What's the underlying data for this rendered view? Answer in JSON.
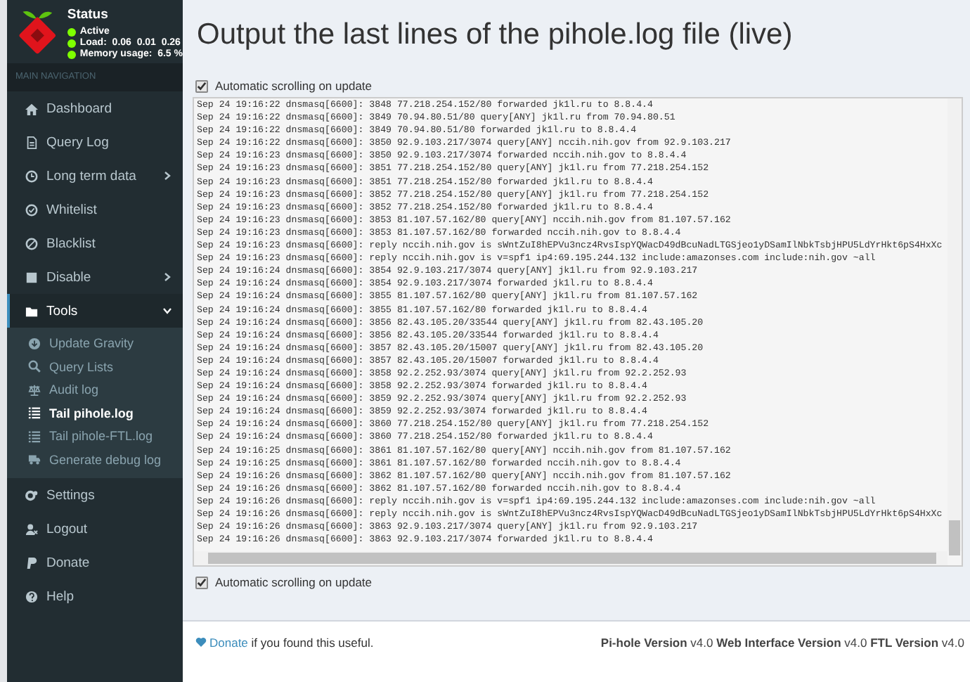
{
  "status": {
    "title": "Status",
    "lines": [
      "Active",
      "Load:  0.06  0.01  0.26",
      "Memory usage:  6.5 %"
    ]
  },
  "sidebar": {
    "header": "MAIN NAVIGATION",
    "items": [
      {
        "label": "Dashboard",
        "selected": false
      },
      {
        "label": "Query Log",
        "selected": false
      },
      {
        "label": "Long term data",
        "selected": false,
        "expanded": false
      },
      {
        "label": "Whitelist",
        "selected": false
      },
      {
        "label": "Blacklist",
        "selected": false
      },
      {
        "label": "Disable",
        "selected": false,
        "expanded": false
      },
      {
        "label": "Tools",
        "selected": true,
        "expanded": true,
        "children": [
          {
            "label": "Update Gravity",
            "selected": false
          },
          {
            "label": "Query Lists",
            "selected": false
          },
          {
            "label": "Audit log",
            "selected": false
          },
          {
            "label": "Tail pihole.log",
            "selected": true
          },
          {
            "label": "Tail pihole-FTL.log",
            "selected": false
          },
          {
            "label": "Generate debug log",
            "selected": false
          }
        ]
      },
      {
        "label": "Settings",
        "selected": false
      },
      {
        "label": "Logout",
        "selected": false
      },
      {
        "label": "Donate",
        "selected": false
      },
      {
        "label": "Help",
        "selected": false
      }
    ]
  },
  "page": {
    "title": "Output the last lines of the pihole.log file (live)",
    "top_option": {
      "label": "Automatic scrolling on update",
      "checked": true
    },
    "log": [
      "Sep 24 19:16:22 dnsmasq[6600]: 3848 77.218.254.152/80 forwarded jk1l.ru to 8.8.4.4",
      "Sep 24 19:16:22 dnsmasq[6600]: 3849 70.94.80.51/80 query[ANY] jk1l.ru from 70.94.80.51",
      "Sep 24 19:16:22 dnsmasq[6600]: 3849 70.94.80.51/80 forwarded jk1l.ru to 8.8.4.4",
      "Sep 24 19:16:22 dnsmasq[6600]: 3850 92.9.103.217/3074 query[ANY] nccih.nih.gov from 92.9.103.217",
      "Sep 24 19:16:23 dnsmasq[6600]: 3850 92.9.103.217/3074 forwarded nccih.nih.gov to 8.8.4.4",
      "Sep 24 19:16:23 dnsmasq[6600]: 3851 77.218.254.152/80 query[ANY] jk1l.ru from 77.218.254.152",
      "Sep 24 19:16:23 dnsmasq[6600]: 3851 77.218.254.152/80 forwarded jk1l.ru to 8.8.4.4",
      "Sep 24 19:16:23 dnsmasq[6600]: 3852 77.218.254.152/80 query[ANY] jk1l.ru from 77.218.254.152",
      "Sep 24 19:16:23 dnsmasq[6600]: 3852 77.218.254.152/80 forwarded jk1l.ru to 8.8.4.4",
      "Sep 24 19:16:23 dnsmasq[6600]: 3853 81.107.57.162/80 query[ANY] nccih.nih.gov from 81.107.57.162",
      "Sep 24 19:16:23 dnsmasq[6600]: 3853 81.107.57.162/80 forwarded nccih.nih.gov to 8.8.4.4",
      "Sep 24 19:16:23 dnsmasq[6600]: reply nccih.nih.gov is sWntZuI8hEPVu3ncz4RvsIspYQWacD49dBcuNadLTGSjeo1yDSamIlNbkTsbjHPU5LdYrHkt6pS4HxXc",
      "Sep 24 19:16:23 dnsmasq[6600]: reply nccih.nih.gov is v=spf1 ip4:69.195.244.132 include:amazonses.com include:nih.gov ~all",
      "Sep 24 19:16:24 dnsmasq[6600]: 3854 92.9.103.217/3074 query[ANY] jk1l.ru from 92.9.103.217",
      "Sep 24 19:16:24 dnsmasq[6600]: 3854 92.9.103.217/3074 forwarded jk1l.ru to 8.8.4.4",
      "Sep 24 19:16:24 dnsmasq[6600]: 3855 81.107.57.162/80 query[ANY] jk1l.ru from 81.107.57.162",
      "Sep 24 19:16:24 dnsmasq[6600]: 3855 81.107.57.162/80 forwarded jk1l.ru to 8.8.4.4",
      "Sep 24 19:16:24 dnsmasq[6600]: 3856 82.43.105.20/33544 query[ANY] jk1l.ru from 82.43.105.20",
      "Sep 24 19:16:24 dnsmasq[6600]: 3856 82.43.105.20/33544 forwarded jk1l.ru to 8.8.4.4",
      "Sep 24 19:16:24 dnsmasq[6600]: 3857 82.43.105.20/15007 query[ANY] jk1l.ru from 82.43.105.20",
      "Sep 24 19:16:24 dnsmasq[6600]: 3857 82.43.105.20/15007 forwarded jk1l.ru to 8.8.4.4",
      "Sep 24 19:16:24 dnsmasq[6600]: 3858 92.2.252.93/3074 query[ANY] jk1l.ru from 92.2.252.93",
      "Sep 24 19:16:24 dnsmasq[6600]: 3858 92.2.252.93/3074 forwarded jk1l.ru to 8.8.4.4",
      "Sep 24 19:16:24 dnsmasq[6600]: 3859 92.2.252.93/3074 query[ANY] jk1l.ru from 92.2.252.93",
      "Sep 24 19:16:24 dnsmasq[6600]: 3859 92.2.252.93/3074 forwarded jk1l.ru to 8.8.4.4",
      "Sep 24 19:16:24 dnsmasq[6600]: 3860 77.218.254.152/80 query[ANY] jk1l.ru from 77.218.254.152",
      "Sep 24 19:16:24 dnsmasq[6600]: 3860 77.218.254.152/80 forwarded jk1l.ru to 8.8.4.4",
      "Sep 24 19:16:25 dnsmasq[6600]: 3861 81.107.57.162/80 query[ANY] nccih.nih.gov from 81.107.57.162",
      "Sep 24 19:16:25 dnsmasq[6600]: 3861 81.107.57.162/80 forwarded nccih.nih.gov to 8.8.4.4",
      "Sep 24 19:16:26 dnsmasq[6600]: 3862 81.107.57.162/80 query[ANY] nccih.nih.gov from 81.107.57.162",
      "Sep 24 19:16:26 dnsmasq[6600]: 3862 81.107.57.162/80 forwarded nccih.nih.gov to 8.8.4.4",
      "Sep 24 19:16:26 dnsmasq[6600]: reply nccih.nih.gov is v=spf1 ip4:69.195.244.132 include:amazonses.com include:nih.gov ~all",
      "Sep 24 19:16:26 dnsmasq[6600]: reply nccih.nih.gov is sWntZuI8hEPVu3ncz4RvsIspYQWacD49dBcuNadLTGSjeo1yDSamIlNbkTsbjHPU5LdYrHkt6pS4HxXc",
      "Sep 24 19:16:26 dnsmasq[6600]: 3863 92.9.103.217/3074 query[ANY] jk1l.ru from 92.9.103.217",
      "Sep 24 19:16:26 dnsmasq[6600]: 3863 92.9.103.217/3074 forwarded jk1l.ru to 8.8.4.4"
    ],
    "bottom_option": {
      "label": "Automatic scrolling on update",
      "checked": true
    }
  },
  "footer": {
    "link": "Donate",
    "note": " if you found this useful.",
    "versions": "**Pi-hole Version** v4.0 **Web Interface Version** v4.0 **FTL Version** v4.0"
  }
}
